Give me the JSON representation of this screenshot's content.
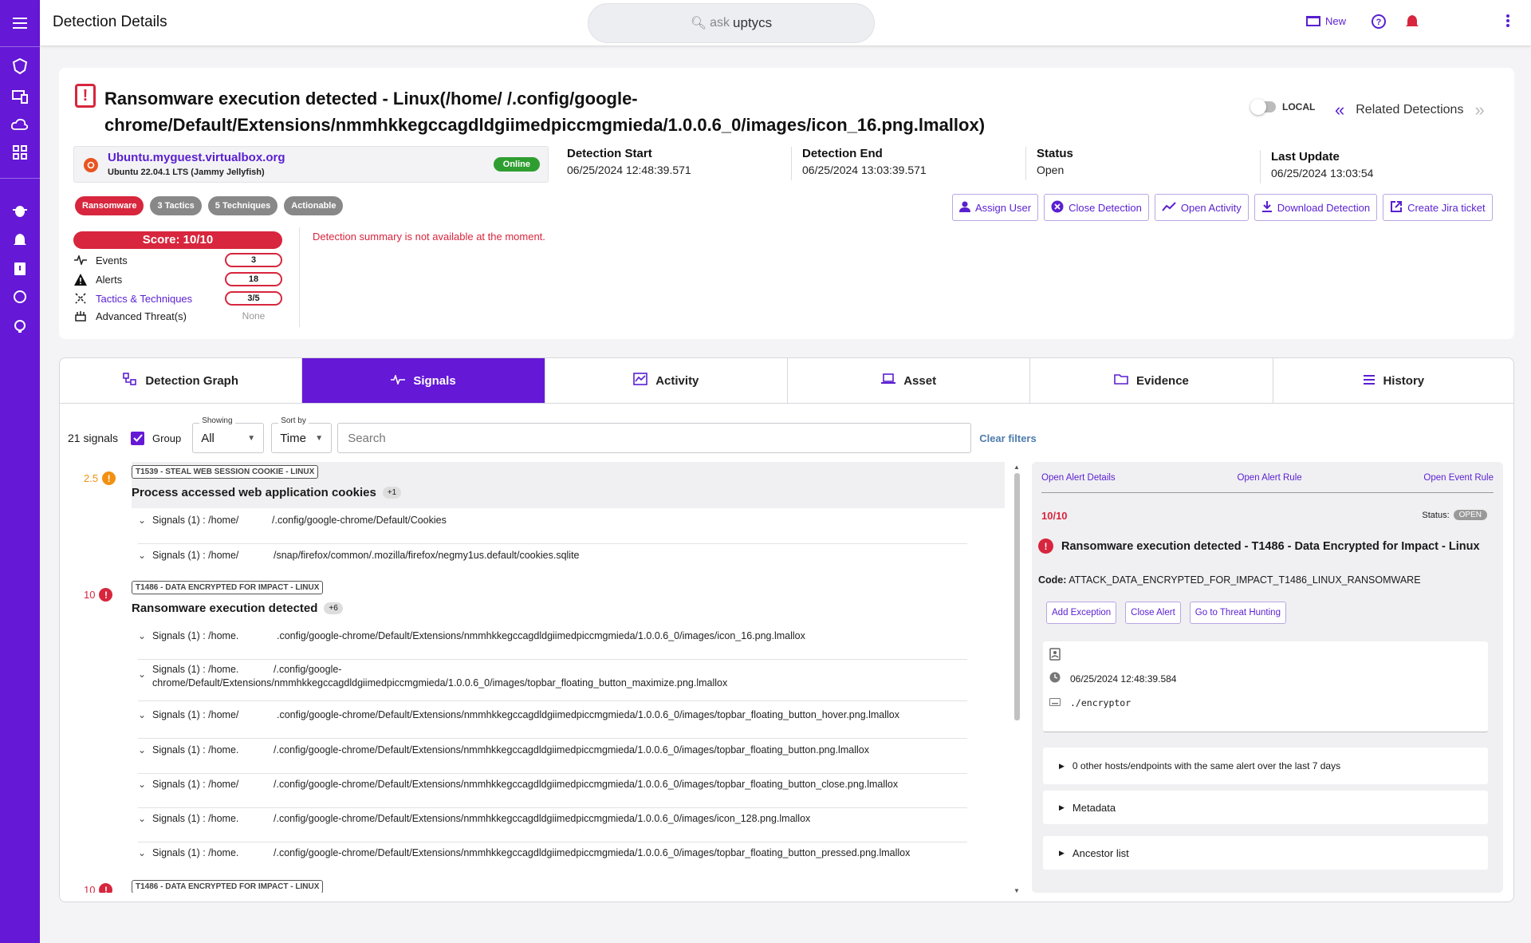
{
  "app": {
    "title": "Detection Details",
    "ask_prefix": "ask",
    "ask_brand": "uptycs",
    "new_label": "New"
  },
  "colors": {
    "brand": "#6518d6",
    "danger": "#d7263d",
    "online": "#2f9e31",
    "warning": "#f29111"
  },
  "detection": {
    "title": "Ransomware execution detected - Linux(/home/              /.config/google-chrome/Default/Extensions/nmmhkkegccagdldgiimedpiccmgmieda/1.0.0.6_0/images/icon_16.png.lmallox)",
    "local_label": "LOCAL",
    "related_label": "Related Detections",
    "host": "Ubuntu.myguest.virtualbox.org",
    "os": "Ubuntu 22.04.1 LTS (Jammy Jellyfish)",
    "host_status": "Online",
    "start_label": "Detection Start",
    "start": "06/25/2024 12:48:39.571",
    "end_label": "Detection End",
    "end": "06/25/2024 13:03:39.571",
    "status_label": "Status",
    "status": "Open",
    "update_label": "Last Update",
    "update": "06/25/2024 13:03:54",
    "tags": [
      "Ransomware",
      "3 Tactics",
      "5 Techniques",
      "Actionable"
    ],
    "actions": [
      "Assign User",
      "Close Detection",
      "Open Activity",
      "Download Detection",
      "Create Jira ticket"
    ],
    "score": "Score: 10/10",
    "stats": {
      "events_label": "Events",
      "events": "3",
      "alerts_label": "Alerts",
      "alerts": "18",
      "tactics_label": "Tactics & Techniques",
      "tactics": "3/5",
      "threats_label": "Advanced Threat(s)",
      "threats": "None"
    },
    "summary": "Detection summary is not available at the moment."
  },
  "tabs": [
    "Detection Graph",
    "Signals",
    "Activity",
    "Asset",
    "Evidence",
    "History"
  ],
  "filters": {
    "count": "21 signals",
    "group_label": "Group",
    "showing_label": "Showing",
    "showing": "All",
    "sort_label": "Sort by",
    "sort": "Time",
    "search_placeholder": "Search",
    "clear": "Clear filters"
  },
  "groups": [
    {
      "score": "2.5",
      "technique": "T1539 - STEAL WEB SESSION COOKIE - LINUX",
      "title": "Process accessed web application cookies",
      "count": "+1",
      "signals": [
        {
          "label": "Signals (1) : /home/",
          "path": "/.config/google-chrome/Default/Cookies"
        },
        {
          "label": "Signals (1) : /home/",
          "path": "/snap/firefox/common/.mozilla/firefox/negmy1us.default/cookies.sqlite"
        }
      ]
    },
    {
      "score": "10",
      "technique": "T1486 - DATA ENCRYPTED FOR IMPACT - LINUX",
      "title": "Ransomware execution detected",
      "count": "+6",
      "signals": [
        {
          "label": "Signals (1) : /home.",
          "path": ".config/google-chrome/Default/Extensions/nmmhkkegccagdldgiimedpiccmgmieda/1.0.0.6_0/images/icon_16.png.lmallox"
        },
        {
          "label": "Signals (1) : /home.",
          "path": "/.config/google-",
          "path2": "chrome/Default/Extensions/nmmhkkegccagdldgiimedpiccmgmieda/1.0.0.6_0/images/topbar_floating_button_maximize.png.lmallox"
        },
        {
          "label": "Signals (1) : /home/",
          "path": ".config/google-chrome/Default/Extensions/nmmhkkegccagdldgiimedpiccmgmieda/1.0.0.6_0/images/topbar_floating_button_hover.png.lmallox"
        },
        {
          "label": "Signals (1) : /home.",
          "path": "/.config/google-chrome/Default/Extensions/nmmhkkegccagdldgiimedpiccmgmieda/1.0.0.6_0/images/topbar_floating_button.png.lmallox"
        },
        {
          "label": "Signals (1) : /home/",
          "path": "/.config/google-chrome/Default/Extensions/nmmhkkegccagdldgiimedpiccmgmieda/1.0.0.6_0/images/topbar_floating_button_close.png.lmallox"
        },
        {
          "label": "Signals (1) : /home.",
          "path": "/.config/google-chrome/Default/Extensions/nmmhkkegccagdldgiimedpiccmgmieda/1.0.0.6_0/images/icon_128.png.lmallox"
        },
        {
          "label": "Signals (1) : /home.",
          "path": "/.config/google-chrome/Default/Extensions/nmmhkkegccagdldgiimedpiccmgmieda/1.0.0.6_0/images/topbar_floating_button_pressed.png.lmallox"
        }
      ]
    },
    {
      "score": "10",
      "technique": "T1486 - DATA ENCRYPTED FOR IMPACT - LINUX"
    }
  ],
  "alert_panel": {
    "links": [
      "Open Alert Details",
      "Open Alert Rule",
      "Open Event Rule"
    ],
    "score": "10/10",
    "status_label": "Status:",
    "status": "OPEN",
    "title": "Ransomware execution detected - T1486 - Data Encrypted for Impact - Linux",
    "code_label": "Code:",
    "code": "ATTACK_DATA_ENCRYPTED_FOR_IMPACT_T1486_LINUX_RANSOMWARE",
    "buttons": [
      "Add Exception",
      "Close Alert",
      "Go to Threat Hunting"
    ],
    "time": "06/25/2024 12:48:39.584",
    "cmd": "./encryptor",
    "other_hosts": "0 other hosts/endpoints with the same alert over the last 7 days",
    "metadata": "Metadata",
    "ancestors": "Ancestor list"
  }
}
